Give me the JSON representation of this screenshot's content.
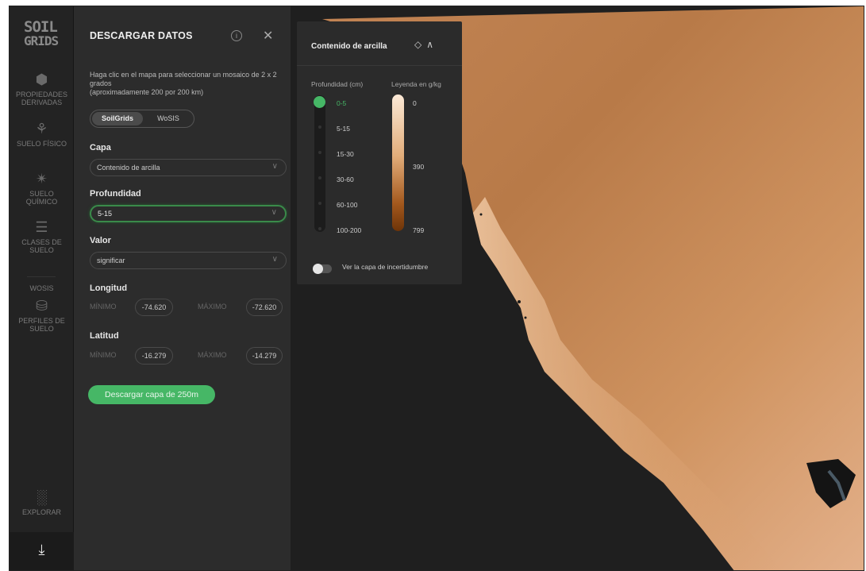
{
  "rail": {
    "logo_line1": "SOIL",
    "logo_line2": "GRIDS",
    "items": [
      {
        "label_1": "PROPIEDADES",
        "label_2": "DERIVADAS",
        "icon": "layers-icon"
      },
      {
        "label_1": "SUELO FÍSICO",
        "label_2": "",
        "icon": "sprout-icon"
      },
      {
        "label_1": "SUELO",
        "label_2": "QUÍMICO",
        "icon": "molecule-icon"
      },
      {
        "label_1": "CLASES DE",
        "label_2": "SUELO",
        "icon": "list-icon"
      },
      {
        "label_1": "WOSIS",
        "label_2": "",
        "icon": ""
      },
      {
        "label_1": "PERFILES DE",
        "label_2": "SUELO",
        "icon": "database-icon"
      },
      {
        "label_1": "EXPLORAR",
        "label_2": "",
        "icon": "explore-chart-icon"
      }
    ],
    "download_icon": "download-icon"
  },
  "panel": {
    "title": "DESCARGAR DATOS",
    "instructions_1": "Haga clic en el mapa para seleccionar un mosaico de 2 x 2 grados",
    "instructions_2": "(aproximadamente 200 por 200 km)",
    "tabs": [
      "SoilGrids",
      "WoSIS"
    ],
    "active_tab": "SoilGrids",
    "layer_label": "Capa",
    "layer_value": "Contenido de arcilla",
    "depth_label": "Profundidad",
    "depth_value": "5-15",
    "value_label": "Valor",
    "value_value": "significar",
    "lon_label": "Longitud",
    "lat_label": "Latitud",
    "min_label": "MÍNIMO",
    "max_label": "MÁXIMO",
    "lon_min": "-74.620",
    "lon_max": "-72.620",
    "lat_min": "-16.279",
    "lat_max": "-14.279",
    "download_button": "Descargar capa de 250m"
  },
  "overlay": {
    "title": "Contenido de arcilla",
    "depth_header": "Profundidad (cm)",
    "legend_header": "Leyenda en g/kg",
    "depths": [
      "0-5",
      "5-15",
      "15-30",
      "30-60",
      "60-100",
      "100-200"
    ],
    "selected_depth": "0-5",
    "legend_values": [
      "0",
      "390",
      "799"
    ],
    "uncertainty_label": "Ver la capa de incertidumbre",
    "uncertainty_on": false
  },
  "colors": {
    "accent": "#46b766",
    "panel_bg": "#2c2c2c",
    "rail_bg": "#232323",
    "land_light": "#e7b588",
    "land_dark": "#a86635",
    "ocean": "#1f1f1f"
  }
}
